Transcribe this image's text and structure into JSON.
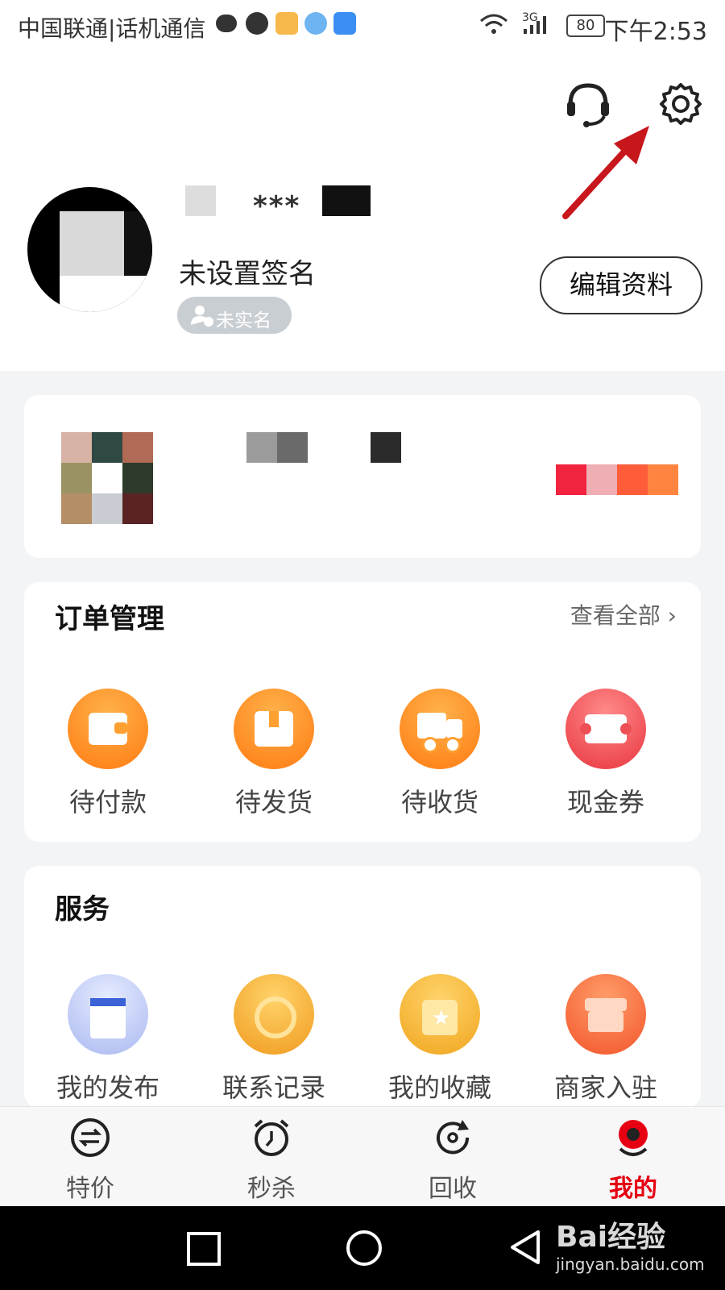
{
  "status_bar": {
    "carrier": "中国联通|话机通信",
    "network": "3G",
    "battery": "80",
    "time": "下午2:53"
  },
  "header": {
    "service_icon": "headset-icon",
    "settings_icon": "gear-icon",
    "nickname": "***",
    "signature": "未设置签名",
    "verify_badge": "未实名",
    "edit_button": "编辑资料"
  },
  "orders": {
    "title": "订单管理",
    "view_all": "查看全部",
    "items": [
      {
        "label": "待付款",
        "icon": "wallet-icon",
        "color": "#ff8a1f"
      },
      {
        "label": "待发货",
        "icon": "package-icon",
        "color": "#ff8a1f"
      },
      {
        "label": "待收货",
        "icon": "truck-icon",
        "color": "#ff8a1f"
      },
      {
        "label": "现金券",
        "icon": "ticket-icon",
        "color": "#ef4a52"
      }
    ]
  },
  "services": {
    "title": "服务",
    "items": [
      {
        "label": "我的发布",
        "icon": "shopping-bag-icon"
      },
      {
        "label": "联系记录",
        "icon": "contact-record-icon"
      },
      {
        "label": "我的收藏",
        "icon": "favorite-bag-icon"
      },
      {
        "label": "商家入驻",
        "icon": "storefront-icon"
      }
    ]
  },
  "bottom_nav": {
    "items": [
      {
        "label": "特价",
        "icon": "exchange-icon",
        "active": false
      },
      {
        "label": "秒杀",
        "icon": "alarm-clock-icon",
        "active": false
      },
      {
        "label": "回收",
        "icon": "recycle-icon",
        "active": false
      },
      {
        "label": "我的",
        "icon": "profile-icon",
        "active": true
      }
    ],
    "active_color": "#e60012"
  },
  "watermark": {
    "brand": "Bai经验",
    "url": "jingyan.baidu.com"
  }
}
